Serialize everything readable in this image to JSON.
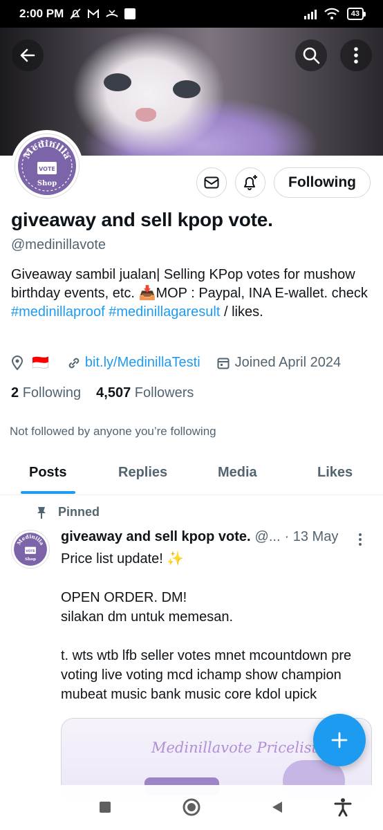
{
  "status_bar": {
    "time": "2:00 PM",
    "battery": "43"
  },
  "header": {
    "back_icon": "arrow-left-icon",
    "search_icon": "search-icon",
    "more_icon": "more-vertical-icon"
  },
  "profile": {
    "avatar_text": {
      "line1": "Medinilla",
      "badge": "VOTE",
      "line2": "Shop"
    },
    "following_button": "Following",
    "display_name": "giveaway and sell kpop vote.",
    "handle": "@medinillavote",
    "bio": {
      "text1": "Giveaway sambil jualan| Selling KPop votes for mushow birthday events, etc. ",
      "emoji": "📥",
      "text2": "MOP : Paypal, INA E-wallet.  check ",
      "tag1": "#medinillaproof",
      "tag2": "#medinillagaresult",
      "text3": " / likes."
    },
    "flag": "🇮🇩",
    "link": "bit.ly/MedinillaTesti",
    "joined": "Joined April 2024",
    "following_count": "2",
    "following_label": "Following",
    "followers_count": "4,507",
    "followers_label": "Followers",
    "not_followed": "Not followed by anyone you’re following"
  },
  "tabs": [
    {
      "label": "Posts",
      "active": true
    },
    {
      "label": "Replies",
      "active": false
    },
    {
      "label": "Media",
      "active": false
    },
    {
      "label": "Likes",
      "active": false
    }
  ],
  "tweet": {
    "pinned_label": "Pinned",
    "name": "giveaway and sell kpop vote.",
    "handle": "@...",
    "date": "· 13 May",
    "line1": "Price list update! ✨",
    "line2": "OPEN ORDER. DM!",
    "line3": "silakan dm untuk memesan.",
    "line4": "t. wts wtb lfb seller votes mnet mcountdown pre voting live voting mcd ichamp show champion mubeat music bank music core kdol upick",
    "media_title": "Medinillavote Pricelist"
  },
  "colors": {
    "accent": "#1d9bf0",
    "muted": "#536471",
    "text": "#0f1419"
  }
}
